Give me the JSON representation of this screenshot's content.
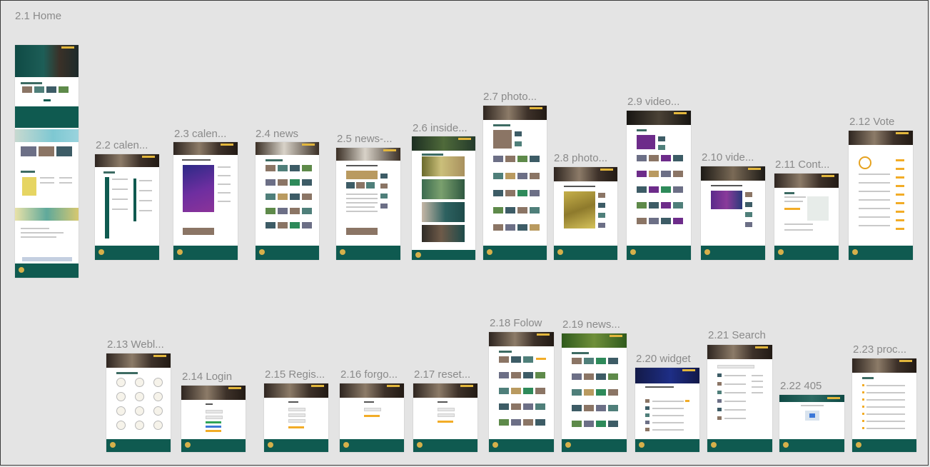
{
  "canvas": {
    "background": "#e4e4e4",
    "frame_title": "2.1 Home"
  },
  "frames": {
    "f1": {
      "label": "2.2 calen..."
    },
    "f2": {
      "label": "2.3 calen..."
    },
    "f3": {
      "label": "2.4 news"
    },
    "f4": {
      "label": "2.5 news-..."
    },
    "f5": {
      "label": "2.6 inside..."
    },
    "f6": {
      "label": "2.7 photo..."
    },
    "f7": {
      "label": "2.8 photo..."
    },
    "f8": {
      "label": "2.9 video..."
    },
    "f9": {
      "label": "2.10 vide..."
    },
    "f10": {
      "label": "2.11 Cont..."
    },
    "f11": {
      "label": "2.12 Vote"
    },
    "f12": {
      "label": "2.13 Webl..."
    },
    "f13": {
      "label": "2.14 Login"
    },
    "f14": {
      "label": "2.15 Regis..."
    },
    "f15": {
      "label": "2.16 forgo..."
    },
    "f16": {
      "label": "2.17 reset..."
    },
    "f17": {
      "label": "2.18 Folow"
    },
    "f18": {
      "label": "2.19 news..."
    },
    "f19": {
      "label": "2.20 widget"
    },
    "f20": {
      "label": "2.21 Search"
    },
    "f21": {
      "label": "2.22 405"
    },
    "f22": {
      "label": "2.23 proc..."
    }
  },
  "colors": {
    "footer_teal": "#0f5a50",
    "accent_orange": "#f2ac27",
    "accent_gold": "#e2b63c",
    "label_gray": "#8a8a8a"
  }
}
